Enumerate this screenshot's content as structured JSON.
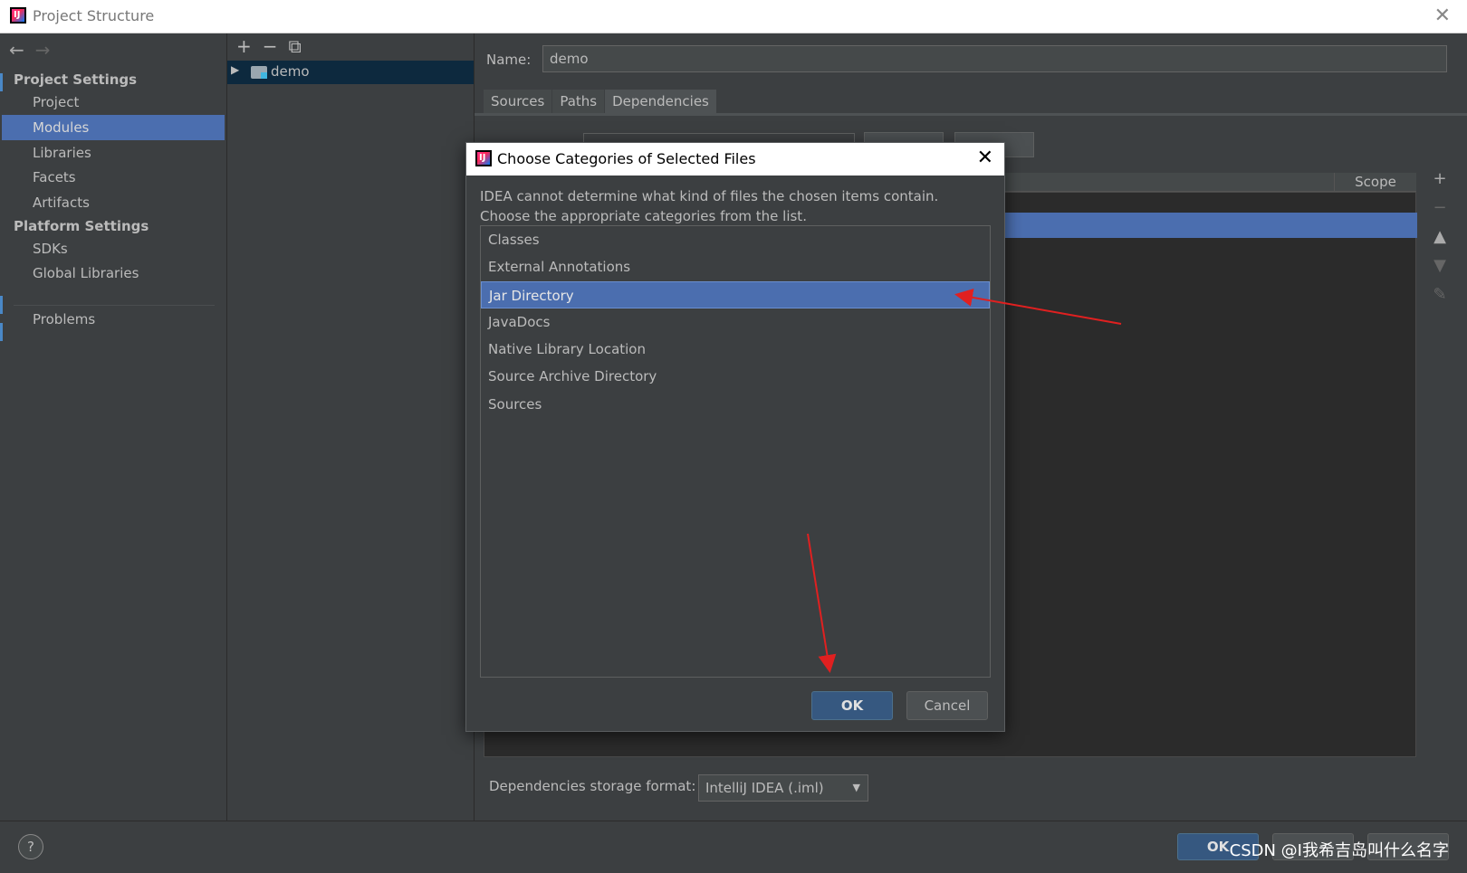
{
  "window": {
    "title": "Project Structure"
  },
  "sidebar": {
    "groups": [
      {
        "label": "Project Settings",
        "items": [
          "Project",
          "Modules",
          "Libraries",
          "Facets",
          "Artifacts"
        ]
      },
      {
        "label": "Platform Settings",
        "items": [
          "SDKs",
          "Global Libraries"
        ]
      }
    ],
    "selected": "Modules",
    "problems": "Problems"
  },
  "tree": {
    "module": "demo"
  },
  "module": {
    "name_label": "Name:",
    "name_value": "demo",
    "tabs": [
      "Sources",
      "Paths",
      "Dependencies"
    ],
    "active_tab": "Dependencies",
    "scope_header": "Scope",
    "storage_label": "Dependencies storage format:",
    "storage_value": "IntelliJ IDEA (.iml)"
  },
  "footer": {
    "ok": "OK",
    "watermark": "CSDN @I我希吉岛叫什么名字"
  },
  "dialog": {
    "title": "Choose Categories of Selected Files",
    "message_line1": "IDEA cannot determine what kind of files the chosen items contain.",
    "message_line2": "Choose the appropriate categories from the list.",
    "categories": [
      "Classes",
      "External Annotations",
      "Jar Directory",
      "JavaDocs",
      "Native Library Location",
      "Source Archive Directory",
      "Sources"
    ],
    "selected": "Jar Directory",
    "ok": "OK",
    "cancel": "Cancel"
  },
  "colors": {
    "selection": "#4b6eaf",
    "annotation_arrow": "#e02020",
    "primary_button": "#365880"
  }
}
